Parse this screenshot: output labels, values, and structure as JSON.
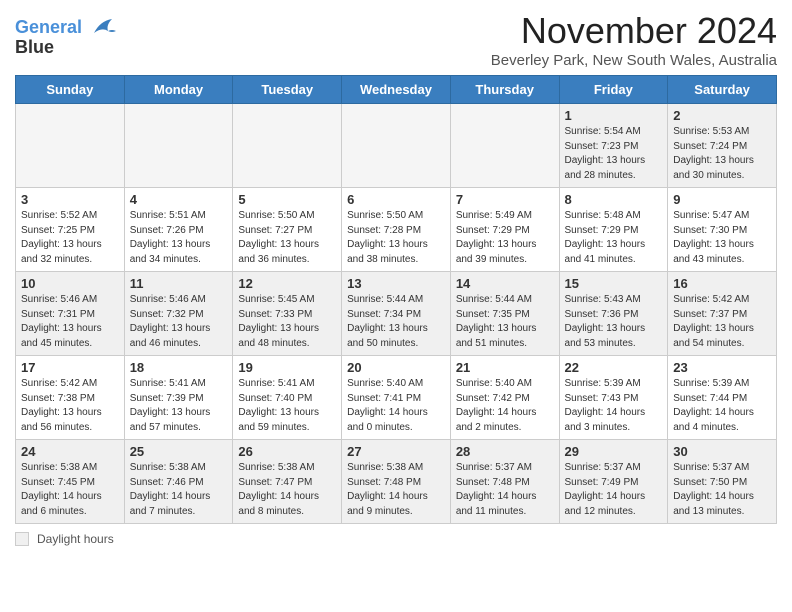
{
  "logo": {
    "line1": "General",
    "line2": "Blue"
  },
  "title": "November 2024",
  "subtitle": "Beverley Park, New South Wales, Australia",
  "days_of_week": [
    "Sunday",
    "Monday",
    "Tuesday",
    "Wednesday",
    "Thursday",
    "Friday",
    "Saturday"
  ],
  "footer_label": "Daylight hours",
  "weeks": [
    [
      {
        "day": "",
        "info": ""
      },
      {
        "day": "",
        "info": ""
      },
      {
        "day": "",
        "info": ""
      },
      {
        "day": "",
        "info": ""
      },
      {
        "day": "",
        "info": ""
      },
      {
        "day": "1",
        "info": "Sunrise: 5:54 AM\nSunset: 7:23 PM\nDaylight: 13 hours\nand 28 minutes."
      },
      {
        "day": "2",
        "info": "Sunrise: 5:53 AM\nSunset: 7:24 PM\nDaylight: 13 hours\nand 30 minutes."
      }
    ],
    [
      {
        "day": "3",
        "info": "Sunrise: 5:52 AM\nSunset: 7:25 PM\nDaylight: 13 hours\nand 32 minutes."
      },
      {
        "day": "4",
        "info": "Sunrise: 5:51 AM\nSunset: 7:26 PM\nDaylight: 13 hours\nand 34 minutes."
      },
      {
        "day": "5",
        "info": "Sunrise: 5:50 AM\nSunset: 7:27 PM\nDaylight: 13 hours\nand 36 minutes."
      },
      {
        "day": "6",
        "info": "Sunrise: 5:50 AM\nSunset: 7:28 PM\nDaylight: 13 hours\nand 38 minutes."
      },
      {
        "day": "7",
        "info": "Sunrise: 5:49 AM\nSunset: 7:29 PM\nDaylight: 13 hours\nand 39 minutes."
      },
      {
        "day": "8",
        "info": "Sunrise: 5:48 AM\nSunset: 7:29 PM\nDaylight: 13 hours\nand 41 minutes."
      },
      {
        "day": "9",
        "info": "Sunrise: 5:47 AM\nSunset: 7:30 PM\nDaylight: 13 hours\nand 43 minutes."
      }
    ],
    [
      {
        "day": "10",
        "info": "Sunrise: 5:46 AM\nSunset: 7:31 PM\nDaylight: 13 hours\nand 45 minutes."
      },
      {
        "day": "11",
        "info": "Sunrise: 5:46 AM\nSunset: 7:32 PM\nDaylight: 13 hours\nand 46 minutes."
      },
      {
        "day": "12",
        "info": "Sunrise: 5:45 AM\nSunset: 7:33 PM\nDaylight: 13 hours\nand 48 minutes."
      },
      {
        "day": "13",
        "info": "Sunrise: 5:44 AM\nSunset: 7:34 PM\nDaylight: 13 hours\nand 50 minutes."
      },
      {
        "day": "14",
        "info": "Sunrise: 5:44 AM\nSunset: 7:35 PM\nDaylight: 13 hours\nand 51 minutes."
      },
      {
        "day": "15",
        "info": "Sunrise: 5:43 AM\nSunset: 7:36 PM\nDaylight: 13 hours\nand 53 minutes."
      },
      {
        "day": "16",
        "info": "Sunrise: 5:42 AM\nSunset: 7:37 PM\nDaylight: 13 hours\nand 54 minutes."
      }
    ],
    [
      {
        "day": "17",
        "info": "Sunrise: 5:42 AM\nSunset: 7:38 PM\nDaylight: 13 hours\nand 56 minutes."
      },
      {
        "day": "18",
        "info": "Sunrise: 5:41 AM\nSunset: 7:39 PM\nDaylight: 13 hours\nand 57 minutes."
      },
      {
        "day": "19",
        "info": "Sunrise: 5:41 AM\nSunset: 7:40 PM\nDaylight: 13 hours\nand 59 minutes."
      },
      {
        "day": "20",
        "info": "Sunrise: 5:40 AM\nSunset: 7:41 PM\nDaylight: 14 hours\nand 0 minutes."
      },
      {
        "day": "21",
        "info": "Sunrise: 5:40 AM\nSunset: 7:42 PM\nDaylight: 14 hours\nand 2 minutes."
      },
      {
        "day": "22",
        "info": "Sunrise: 5:39 AM\nSunset: 7:43 PM\nDaylight: 14 hours\nand 3 minutes."
      },
      {
        "day": "23",
        "info": "Sunrise: 5:39 AM\nSunset: 7:44 PM\nDaylight: 14 hours\nand 4 minutes."
      }
    ],
    [
      {
        "day": "24",
        "info": "Sunrise: 5:38 AM\nSunset: 7:45 PM\nDaylight: 14 hours\nand 6 minutes."
      },
      {
        "day": "25",
        "info": "Sunrise: 5:38 AM\nSunset: 7:46 PM\nDaylight: 14 hours\nand 7 minutes."
      },
      {
        "day": "26",
        "info": "Sunrise: 5:38 AM\nSunset: 7:47 PM\nDaylight: 14 hours\nand 8 minutes."
      },
      {
        "day": "27",
        "info": "Sunrise: 5:38 AM\nSunset: 7:48 PM\nDaylight: 14 hours\nand 9 minutes."
      },
      {
        "day": "28",
        "info": "Sunrise: 5:37 AM\nSunset: 7:48 PM\nDaylight: 14 hours\nand 11 minutes."
      },
      {
        "day": "29",
        "info": "Sunrise: 5:37 AM\nSunset: 7:49 PM\nDaylight: 14 hours\nand 12 minutes."
      },
      {
        "day": "30",
        "info": "Sunrise: 5:37 AM\nSunset: 7:50 PM\nDaylight: 14 hours\nand 13 minutes."
      }
    ]
  ]
}
